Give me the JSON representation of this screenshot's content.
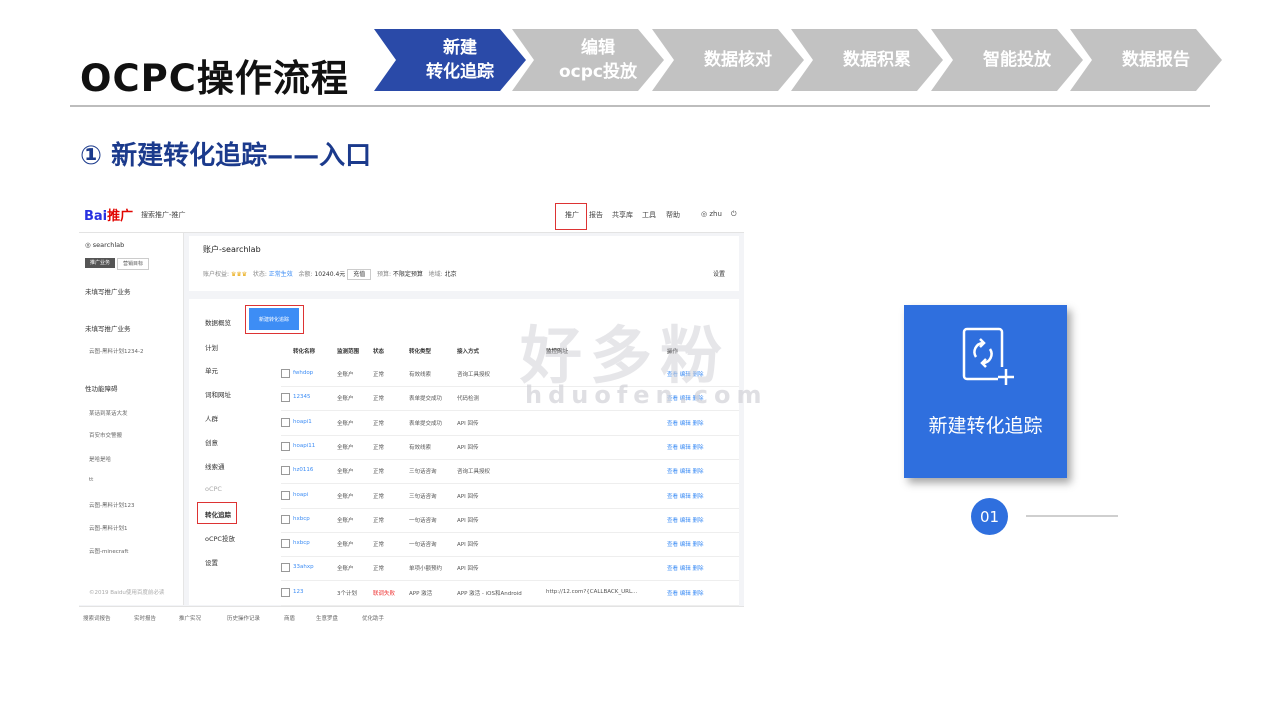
{
  "page": {
    "title": "OCPC操作流程",
    "subtitle": "① 新建转化追踪——入口"
  },
  "steps": [
    {
      "line1": "新建",
      "line2": "转化追踪",
      "active": true,
      "color": "#2a4aa8"
    },
    {
      "line1": "编辑",
      "line2": "ocpc投放",
      "active": false,
      "color": "#c2c2c2"
    },
    {
      "line1": "数据核对",
      "line2": "",
      "active": false,
      "color": "#c2c2c2"
    },
    {
      "line1": "数据积累",
      "line2": "",
      "active": false,
      "color": "#c2c2c2"
    },
    {
      "line1": "智能投放",
      "line2": "",
      "active": false,
      "color": "#c2c2c2"
    },
    {
      "line1": "数据报告",
      "line2": "",
      "active": false,
      "color": "#c2c2c2"
    }
  ],
  "screenshot": {
    "logo": "Bai",
    "logo_suffix": "推广",
    "breadcrumb": "搜索推广-推广",
    "nav": [
      "推广",
      "报告",
      "共享库",
      "工具",
      "帮助"
    ],
    "user": "zhu",
    "account_user": "searchlab",
    "sidebar_tabs": [
      "推广业务",
      "营销目标"
    ],
    "sidebar_items": [
      "未填写推广业务",
      "未填写推广业务",
      "云图-黑料计划1234-2",
      "性功能障碍",
      "某话到某话大发",
      "百安市交警搬",
      "是哈是哈",
      "tt",
      "云图-黑料计划123",
      "云图-黑料计划1",
      "云图-minecraft"
    ],
    "sidebar_footer": "©2019 Baidu使用百度前必读",
    "account_title": "账户-searchlab",
    "account_info": {
      "rights_label": "账户权益:",
      "status_label": "状态:",
      "status_value": "正常生效",
      "balance_label": "余额:",
      "balance_value": "10240.4元",
      "recharge": "充值",
      "budget_label": "预算:",
      "budget_value": "不限定预算",
      "region_label": "地域:",
      "region_value": "北京",
      "settings": "设置"
    },
    "left_nav": [
      "数据概览",
      "计划",
      "单元",
      "词和网址",
      "人群",
      "创意",
      "线索通",
      "oCPC",
      "转化追踪",
      "oCPC投放",
      "设置"
    ],
    "new_button": "新建转化追踪",
    "table_headers": [
      "转化名称",
      "监测范围",
      "状态",
      "转化类型",
      "接入方式",
      "监控网址",
      "操作"
    ],
    "rows": [
      {
        "name": "fwhdop",
        "scope": "全账户",
        "status": "正常",
        "type": "有效线索",
        "method": "咨询工具授权",
        "url": "",
        "ops": "查看 编辑 删除"
      },
      {
        "name": "12345",
        "scope": "全账户",
        "status": "正常",
        "type": "表单提交成功",
        "method": "代码检测",
        "url": "",
        "ops": "查看 编辑 删除"
      },
      {
        "name": "hoapi1",
        "scope": "全账户",
        "status": "正常",
        "type": "表单提交成功",
        "method": "API 回传",
        "url": "",
        "ops": "查看 编辑 删除"
      },
      {
        "name": "hoapi11",
        "scope": "全账户",
        "status": "正常",
        "type": "有效线索",
        "method": "API 回传",
        "url": "",
        "ops": "查看 编辑 删除"
      },
      {
        "name": "hz0116",
        "scope": "全账户",
        "status": "正常",
        "type": "三句话咨询",
        "method": "咨询工具授权",
        "url": "",
        "ops": "查看 编辑 删除"
      },
      {
        "name": "hoapi",
        "scope": "全账户",
        "status": "正常",
        "type": "三句话咨询",
        "method": "API 回传",
        "url": "",
        "ops": "查看 编辑 删除"
      },
      {
        "name": "hxbcp",
        "scope": "全账户",
        "status": "正常",
        "type": "一句话咨询",
        "method": "API 回传",
        "url": "",
        "ops": "查看 编辑 删除"
      },
      {
        "name": "hxbcp",
        "scope": "全账户",
        "status": "正常",
        "type": "一句话咨询",
        "method": "API 回传",
        "url": "",
        "ops": "查看 编辑 删除"
      },
      {
        "name": "33ahxp",
        "scope": "全账户",
        "status": "正常",
        "type": "单项小额预约",
        "method": "API 回传",
        "url": "",
        "ops": "查看 编辑 删除"
      },
      {
        "name": "123",
        "scope": "3个计划",
        "status": "联调失败",
        "type": "APP 激活",
        "method": "APP 激活 - iOS和Android",
        "url": "http://12.com?{CALLBACK_URL...",
        "ops": "查看 编辑 删除"
      }
    ],
    "footer_items": [
      "搜索词报告",
      "实时报告",
      "推广实况",
      "历史操作记录",
      "商盾",
      "生意罗盘",
      "优化助手"
    ]
  },
  "watermark": {
    "line1": "好多粉",
    "line2": "hduofen.com"
  },
  "card": {
    "label": "新建转化追踪",
    "icon": "refresh-plus-icon",
    "color": "#2f6fde"
  },
  "badge": {
    "number": "01"
  }
}
